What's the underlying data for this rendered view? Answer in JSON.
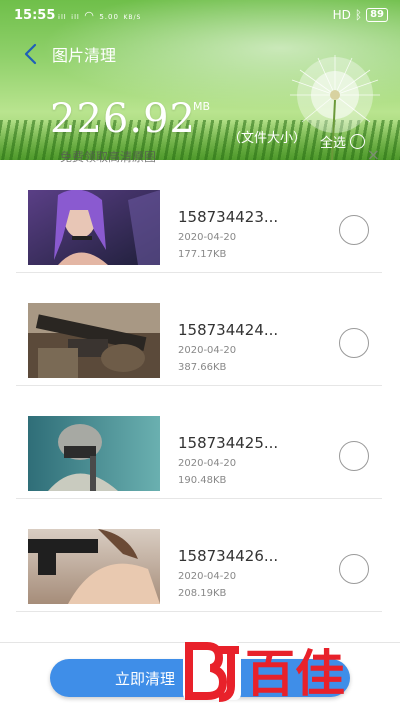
{
  "status_bar": {
    "time": "15:55",
    "signal_text": "ᵢₗₗ ᵢₗₗ",
    "speed_value": "5.00",
    "speed_unit": "KB/S",
    "network": "HD",
    "battery": "89"
  },
  "header": {
    "title": "图片清理",
    "total_size": "226.92",
    "size_unit": "MB",
    "size_caption": "（文件大小）",
    "select_all_label": "全选",
    "ad_text": "免费领取高清原图"
  },
  "images": [
    {
      "name": "158734423...",
      "date": "2020-04-20",
      "size": "177.17KB",
      "selected": false,
      "thumb": "game-character-purple-hair"
    },
    {
      "name": "158734424...",
      "date": "2020-04-20",
      "size": "387.66KB",
      "selected": false,
      "thumb": "rifle-closeup"
    },
    {
      "name": "158734425...",
      "date": "2020-04-20",
      "size": "190.48KB",
      "selected": false,
      "thumb": "helmet-soldier"
    },
    {
      "name": "158734426...",
      "date": "2020-04-20",
      "size": "208.19KB",
      "selected": false,
      "thumb": "character-with-gun"
    }
  ],
  "bottom": {
    "clean_button_label": "立即清理"
  },
  "watermark": {
    "text": "百佳"
  },
  "colors": {
    "accent": "#3f8ee8",
    "header_green": "#8fd06a",
    "watermark_red": "#e8212a"
  }
}
